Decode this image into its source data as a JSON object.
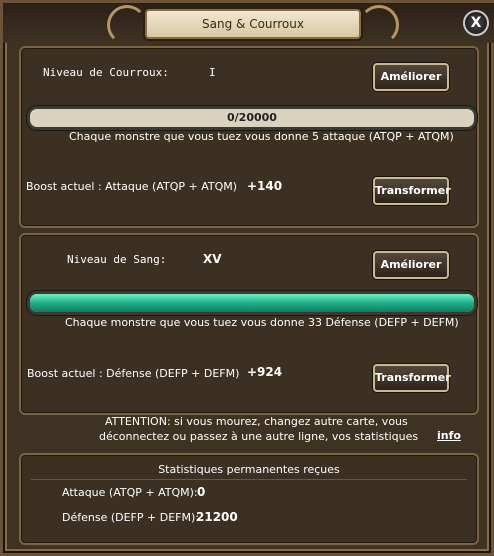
{
  "window": {
    "title": "Sang & Courroux",
    "close_label": "X"
  },
  "courroux": {
    "level_label": "Niveau de Courroux:",
    "level_value": "I",
    "improve_label": "Améliorer",
    "progress_text": "0/20000",
    "progress_fraction": 0.0,
    "description": "Chaque monstre que vous tuez vous donne 5 attaque (ATQP + ATQM)",
    "boost_label": "Boost actuel : Attaque (ATQP + ATQM)",
    "boost_value": "+140",
    "transform_label": "Transformer"
  },
  "sang": {
    "level_label": "Niveau de Sang:",
    "level_value": "XV",
    "improve_label": "Améliorer",
    "progress_fraction": 1.0,
    "description": "Chaque monstre que vous tuez vous donne 33 Défense (DEFP + DEFM)",
    "boost_label": "Boost actuel : Défense (DEFP + DEFM)",
    "boost_value": "+924",
    "transform_label": "Transformer"
  },
  "warning": {
    "line1": "ATTENTION: si vous mourez, changez autre carte, vous",
    "line2": "déconnectez ou passez à une autre ligne, vos statistiques",
    "info_link": "info"
  },
  "permanent": {
    "title": "Statistiques permanentes reçues",
    "attack_label": "Attaque (ATQP + ATQM):",
    "attack_value": "0",
    "defense_label": "Défense (DEFP + DEFM):",
    "defense_value": "21200"
  },
  "colors": {
    "panel_bg": "#3b3022",
    "border": "#7b6444",
    "bar_fill": "#1fb089"
  }
}
